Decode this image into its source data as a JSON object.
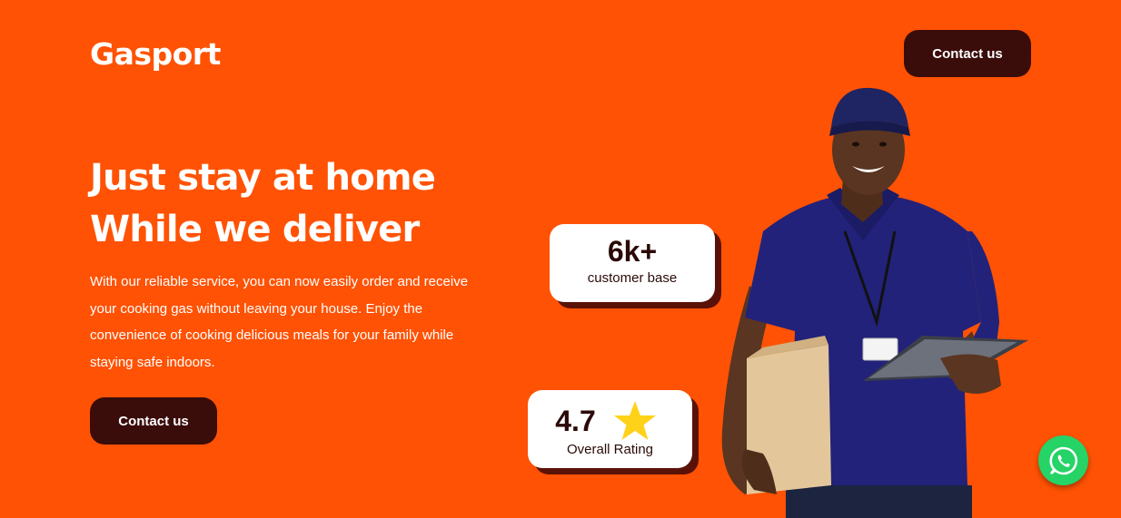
{
  "brand": {
    "logo_text": "Gasport"
  },
  "header": {
    "contact_label": "Contact us"
  },
  "hero": {
    "headline_line1": "Just stay at home",
    "headline_line2": "While we deliver",
    "description": "With our reliable service, you can now easily order and receive your cooking gas without leaving your house. Enjoy the convenience of cooking delicious meals for your family while staying safe indoors.",
    "cta_label": "Contact us"
  },
  "stats": {
    "customers": {
      "value": "6k+",
      "label": "customer base"
    },
    "rating": {
      "value": "4.7",
      "label": "Overall Rating"
    }
  },
  "colors": {
    "background": "#ff5204",
    "button": "#3a0d0a",
    "card_shadow": "#5a1208",
    "star": "#ffd21a",
    "whatsapp": "#25d366"
  },
  "icons": {
    "rating": "star-icon",
    "chat": "whatsapp-icon"
  }
}
